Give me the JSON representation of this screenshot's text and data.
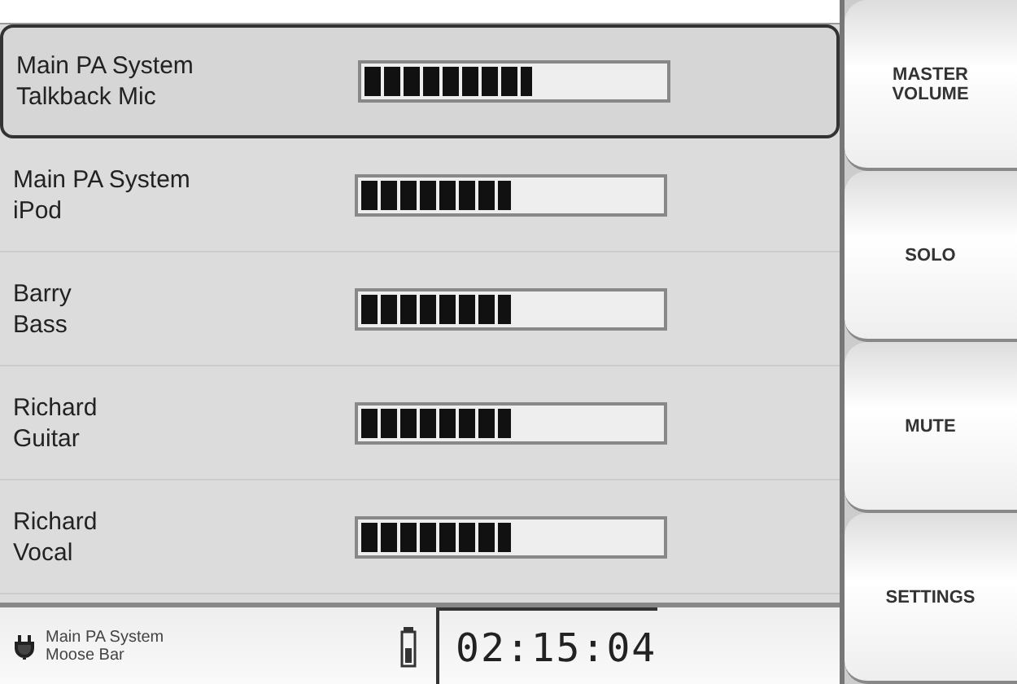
{
  "channels": [
    {
      "name": "Main PA System\nTalkback Mic",
      "level": 0.56,
      "selected": true
    },
    {
      "name": "Main PA System\niPod",
      "level": 0.5,
      "selected": false
    },
    {
      "name": "Barry\nBass",
      "level": 0.5,
      "selected": false
    },
    {
      "name": "Richard\nGuitar",
      "level": 0.5,
      "selected": false
    },
    {
      "name": "Richard\nVocal",
      "level": 0.5,
      "selected": false
    }
  ],
  "buttons": [
    {
      "label": "MASTER\nVOLUME"
    },
    {
      "label": "SOLO"
    },
    {
      "label": "MUTE"
    },
    {
      "label": "SETTINGS"
    }
  ],
  "status_bar": {
    "system": "Main PA System",
    "venue": "Moose Bar",
    "time": "02:15:04"
  }
}
